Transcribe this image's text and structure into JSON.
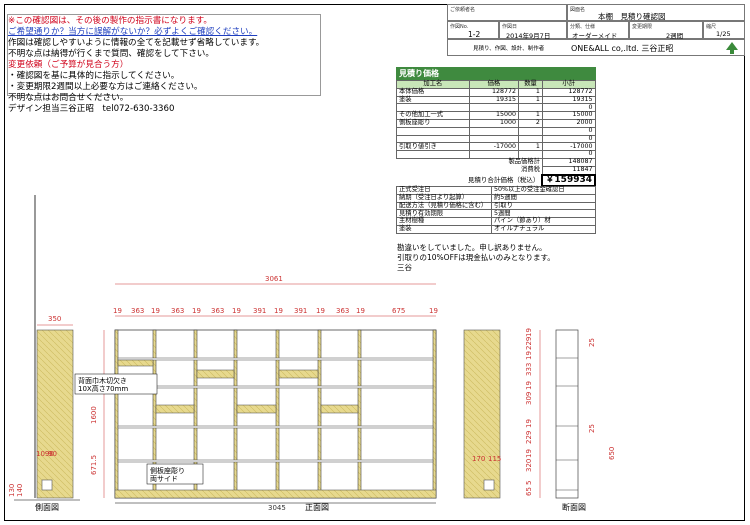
{
  "notes": {
    "lines": [
      {
        "text": "※この確認図は、その後の製作の指示書になります。",
        "color": "red"
      },
      {
        "text": "ご希望通りか？当方に誤解がないか？必ずよくご確認ください。",
        "color": "blue"
      },
      {
        "text": "作図は確認しやすいように情報の全てを記載せず省略しています。",
        "color": "black"
      },
      {
        "text": "不明な点は納得が行くまで質問、確認をして下さい。",
        "color": "black"
      },
      {
        "text": "変更依頼（ご予算が見合う方）",
        "color": "red"
      },
      {
        "text": "・確認図を基に具体的に指示してください。",
        "color": "black"
      },
      {
        "text": "・変更期限2週間以上必要な方はご連絡ください。",
        "color": "black"
      },
      {
        "text": "不明な点はお問合せください。",
        "color": "black"
      },
      {
        "text": "デザイン担当三谷正昭　tel072-630-3360",
        "color": "black"
      }
    ]
  },
  "title_block": {
    "customer_label": "ご依頼者名",
    "drawing_name_label": "図面名",
    "drawing_name": "本棚　見積り確認図",
    "drawing_no_label": "作図No.",
    "drawing_no": "1-2",
    "date_label": "作図日",
    "date": "2014年9月7日",
    "category_label": "分類、仕様",
    "category": "オーダーメイド",
    "deadline_label": "変更期限",
    "deadline": "2週間",
    "scale_label": "縮尺",
    "scale": "1/25",
    "company_label": "見積り、作図、設計、制作者",
    "company": "ONE&ALL co,.ltd. 三谷正昭"
  },
  "estimate": {
    "title": "見積り価格",
    "headers": [
      "加工名",
      "価格",
      "数量",
      "小計"
    ],
    "rows": [
      [
        "本体価格",
        "128772",
        "1",
        "128772"
      ],
      [
        "塗装",
        "19315",
        "1",
        "19315"
      ],
      [
        "",
        "",
        "",
        "0"
      ],
      [
        "その他加工一式",
        "15000",
        "1",
        "15000"
      ],
      [
        "側板座彫り",
        "1000",
        "2",
        "2000"
      ],
      [
        "",
        "",
        "",
        "0"
      ],
      [
        "",
        "",
        "",
        "0"
      ],
      [
        "引取り値引き",
        "-17000",
        "1",
        "-17000"
      ],
      [
        "",
        "",
        "",
        "0"
      ]
    ],
    "subtotal_label": "製品価格計",
    "subtotal": "148087",
    "tax_label": "消費税",
    "tax": "11847",
    "total_label": "見積り合計価格（税込）",
    "total": "￥159934"
  },
  "info": {
    "rows": [
      [
        "正式受注日",
        "50%以上の受注金確認日"
      ],
      [
        "納期（受注日より起算）",
        "約5週間"
      ],
      [
        "配送方法（見積り価格に含む）",
        "引取り"
      ],
      [
        "見積り有効期限",
        "5週間"
      ],
      [
        "主材樹種",
        "パイン（節あり）材"
      ],
      [
        "塗装",
        "オイルナチュラル"
      ]
    ]
  },
  "apology": {
    "lines": [
      "勘違いをしていました。申し訳ありません。",
      "引取りの10%OFFは現金払いのみとなります。",
      "三谷"
    ]
  },
  "front": {
    "overall_width": "3061",
    "bottom_width": "3045",
    "top_dims": [
      "19",
      "363",
      "19",
      "363",
      "19",
      "363",
      "19",
      "391",
      "19",
      "391",
      "19",
      "363",
      "19",
      "675",
      "19"
    ],
    "height_upper": "1600",
    "height_lower": "671.5",
    "callout_back": "背面巾木切欠き\n10X高さ70mm",
    "callout_side": "側板座彫り\n両サイド",
    "caption": "正面図"
  },
  "side": {
    "depth": "350",
    "dim_top": "1090",
    "dim_bot1": "130",
    "dim_bot2": "140",
    "caption": "側面図",
    "right_dims": [
      "170",
      "115"
    ]
  },
  "section": {
    "dims": [
      "19",
      "229",
      "19",
      "333",
      "19",
      "309",
      "19",
      "229",
      "19",
      "320",
      "5",
      "65"
    ],
    "dims_right": [
      "25",
      "25",
      "650"
    ],
    "caption": "断面図"
  }
}
